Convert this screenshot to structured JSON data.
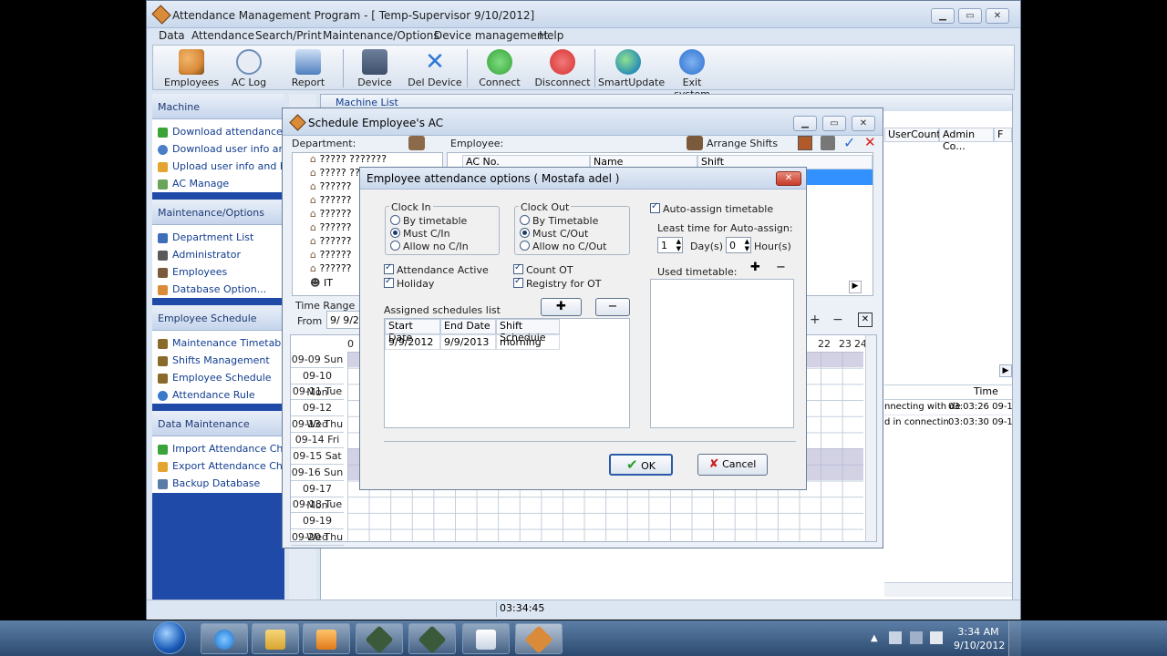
{
  "main_window": {
    "title": "Attendance Management Program - [ Temp-Supervisor 9/10/2012]",
    "menu": [
      "Data",
      "Attendance",
      "Search/Print",
      "Maintenance/Options",
      "Device management",
      "Help"
    ],
    "toolbar": [
      {
        "label": "Employees",
        "icon": "employees-icon",
        "color": "#d98b3a"
      },
      {
        "label": "AC Log",
        "icon": "clock-icon",
        "color": "#6f8fb8"
      },
      {
        "label": "Report",
        "icon": "report-icon",
        "color": "#4f7fbf"
      },
      {
        "label": "Device",
        "icon": "device-icon",
        "color": "#3d4f6b"
      },
      {
        "label": "Del Device",
        "icon": "delete-x-icon",
        "color": "#2f78d8"
      },
      {
        "label": "Connect",
        "icon": "connect-icon",
        "color": "#35a33a"
      },
      {
        "label": "Disconnect",
        "icon": "disconnect-icon",
        "color": "#d83030"
      },
      {
        "label": "SmartUpdate",
        "icon": "globe-icon",
        "color": "#2a8fb5"
      },
      {
        "label": "Exit system",
        "icon": "power-icon",
        "color": "#2a6fd0"
      }
    ]
  },
  "sidebar": {
    "machine": {
      "header": "Machine",
      "items": [
        "Download attendance logs",
        "Download user info and Fp",
        "Upload user info and FP",
        "AC Manage"
      ]
    },
    "maintenance": {
      "header": "Maintenance/Options",
      "items": [
        "Department List",
        "Administrator",
        "Employees",
        "Database Option..."
      ]
    },
    "schedule": {
      "header": "Employee Schedule",
      "items": [
        "Maintenance Timetables",
        "Shifts Management",
        "Employee Schedule",
        "Attendance Rule"
      ]
    },
    "data": {
      "header": "Data Maintenance",
      "items": [
        "Import Attendance Checkin",
        "Export Attendance Checkin",
        "Backup Database"
      ]
    }
  },
  "machine_list": {
    "title": "Machine List",
    "columns": [
      "UserCount",
      "Admin Co...",
      "F"
    ]
  },
  "log_panel": {
    "column": "Time",
    "rows": [
      {
        "msg": "nnecting with de",
        "time": "03:03:26 09-10"
      },
      {
        "msg": "d in connectin",
        "time": "03:03:30 09-10"
      }
    ]
  },
  "status": {
    "time": "03:34:45"
  },
  "schedule_dialog": {
    "title": "Schedule Employee's AC",
    "department_label": "Department:",
    "employee_label": "Employee:",
    "arrange_shifts": "Arrange Shifts",
    "departments": [
      "????? ???????",
      "????? ??",
      "??????",
      "??????",
      "??????",
      "??????",
      "??????",
      "??????",
      "??????",
      "IT"
    ],
    "columns": [
      "AC No.",
      "Name",
      "Shift"
    ],
    "time_range_label": "Time Range",
    "from_label": "From",
    "from_value": "9/  9/2",
    "hours": [
      "0",
      "22",
      "23",
      "24"
    ],
    "days": [
      "09-09 Sun",
      "09-10 Mon",
      "09-11 Tue",
      "09-12 Wed",
      "09-13 Thu",
      "09-14 Fri",
      "09-15 Sat",
      "09-16 Sun",
      "09-17 Mon",
      "09-18 Tue",
      "09-19 Wed",
      "09-20 Thu"
    ]
  },
  "options_dialog": {
    "title": "Employee attendance options ( Mostafa adel )",
    "clock_in": {
      "label": "Clock In",
      "options": [
        "By timetable",
        "Must C/In",
        "Allow no C/In"
      ],
      "selected": 1
    },
    "clock_out": {
      "label": "Clock Out",
      "options": [
        "By Timetable",
        "Must C/Out",
        "Allow no C/Out"
      ],
      "selected": 1
    },
    "attendance_active": "Attendance Active",
    "holiday": "Holiday",
    "count_ot": "Count OT",
    "registry_ot": "Registry for OT",
    "auto_assign": "Auto-assign timetable",
    "least_time_label": "Least time for Auto-assign:",
    "days_value": "1",
    "days_unit": "Day(s)",
    "hours_value": "0",
    "hours_unit": "Hour(s)",
    "used_timetable": "Used timetable:",
    "assigned_list_label": "Assigned schedules list",
    "assigned_columns": [
      "Start Date",
      "End Date",
      "Shift Schedule"
    ],
    "assigned_rows": [
      {
        "start": "9/9/2012",
        "end": "9/9/2013",
        "shift": "morning"
      }
    ],
    "ok": "OK",
    "cancel": "Cancel"
  },
  "taskbar": {
    "time": "3:34 AM",
    "date": "9/10/2012"
  }
}
